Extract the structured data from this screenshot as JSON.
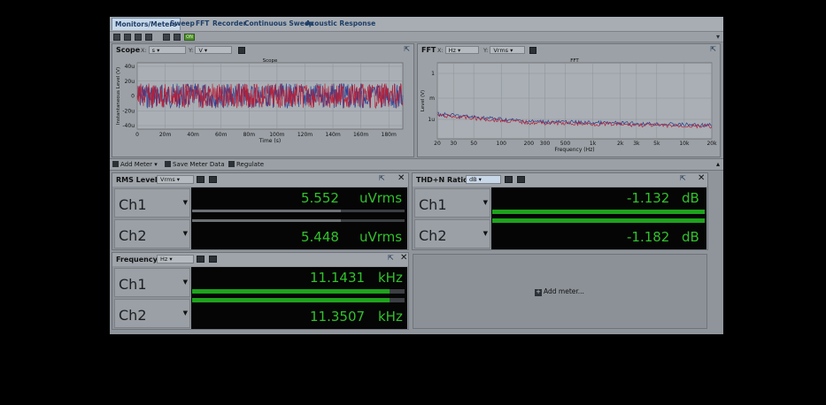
{
  "tabs": [
    "Monitors/Meters",
    "Sweep",
    "FFT",
    "Recorder",
    "Continuous Sweep",
    "Acoustic Response"
  ],
  "toolbar": {
    "on_label": "ON"
  },
  "scope": {
    "title": "Scope",
    "x_unit": "s",
    "y_unit": "V",
    "x_label": "X:",
    "y_label": "Y:"
  },
  "fft": {
    "title": "FFT",
    "x_unit": "Hz",
    "y_unit": "Vrms",
    "x_label": "X:",
    "y_label": "Y:"
  },
  "meterbar": {
    "add_meter": "Add Meter",
    "save_data": "Save Meter Data",
    "regulate": "Regulate"
  },
  "meters": {
    "rms": {
      "title": "RMS Level",
      "unit_select": "Vrms",
      "rows": [
        {
          "ch": "Ch1",
          "value": "5.552",
          "unit": "uVrms",
          "fill": 0.7
        },
        {
          "ch": "Ch2",
          "value": "5.448",
          "unit": "uVrms",
          "fill": 0.7
        }
      ]
    },
    "thdn": {
      "title": "THD+N Ratio",
      "unit_select": "dB",
      "rows": [
        {
          "ch": "Ch1",
          "value": "-1.132",
          "unit": "dB",
          "fill": 1.0
        },
        {
          "ch": "Ch2",
          "value": "-1.182",
          "unit": "dB",
          "fill": 1.0
        }
      ]
    },
    "freq": {
      "title": "Frequency",
      "unit_select": "Hz",
      "rows": [
        {
          "ch": "Ch1",
          "value": "11.1431",
          "unit": "kHz",
          "fill": 0.93
        },
        {
          "ch": "Ch2",
          "value": "11.3507",
          "unit": "kHz",
          "fill": 0.93
        }
      ]
    }
  },
  "add_meter_placeholder": "Add meter...",
  "chart_data": [
    {
      "type": "line",
      "title": "Scope",
      "xlabel": "Time (s)",
      "ylabel": "Instantaneous Level (V)",
      "x_ticks": [
        "0",
        "20m",
        "40m",
        "60m",
        "80m",
        "100m",
        "120m",
        "140m",
        "160m",
        "180m"
      ],
      "y_ticks": [
        "40u",
        "20u",
        "0",
        "-20u",
        "-40u"
      ],
      "xlim": [
        0,
        0.19
      ],
      "ylim": [
        -4e-05,
        4e-05
      ],
      "grid": true,
      "series_colors": [
        "#2a3d8f",
        "#b3203a"
      ],
      "noise_amplitude_v": 1.5e-05
    },
    {
      "type": "line",
      "title": "FFT",
      "xlabel": "Frequency (Hz)",
      "ylabel": "Level (V)",
      "x_ticks": [
        "20",
        "30",
        "50",
        "100",
        "200",
        "300",
        "500",
        "1k",
        "2k",
        "3k",
        "5k",
        "10k",
        "20k"
      ],
      "y_ticks": [
        "1",
        "m",
        "1u"
      ],
      "xlim": [
        20,
        20000
      ],
      "x_scale": "log",
      "grid": true,
      "series_colors": [
        "#2a3d8f",
        "#b3203a"
      ]
    }
  ]
}
